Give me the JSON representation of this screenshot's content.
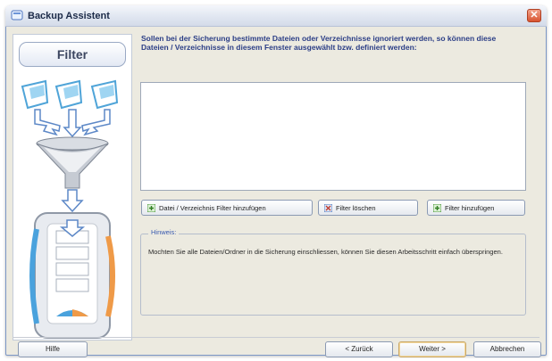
{
  "window": {
    "title": "Backup Assistent",
    "close_glyph": "✕"
  },
  "sidebar": {
    "header": "Filter"
  },
  "main": {
    "instruction": "Sollen bei der Sicherung bestimmte Dateien oder Verzeichnisse ignoriert werden, so können diese Dateien / Verzeichnisse in diesem Fenster ausgewählt bzw. definiert werden:",
    "buttons": {
      "add_path_filter": "Datei / Verzeichnis Filter hinzufügen",
      "delete_filter": "Filter löschen",
      "add_filter": "Filter hinzufügen"
    },
    "hint": {
      "label": "Hinweis:",
      "text": "Mochten Sie alle Dateien/Ordner in die Sicherung einschliessen, können Sie diesen Arbeitsschritt einfach überspringen."
    }
  },
  "footer": {
    "help": "Hilfe",
    "back": "< Zurück",
    "next": "Weiter >",
    "cancel": "Abbrechen"
  },
  "icons": {
    "add": "plus-icon",
    "delete": "delete-icon"
  },
  "colors": {
    "instruction_text": "#2b3e86",
    "hint_label": "#3b5cb0",
    "dialog_bg": "#eceae0",
    "close_button": "#d8532f"
  }
}
